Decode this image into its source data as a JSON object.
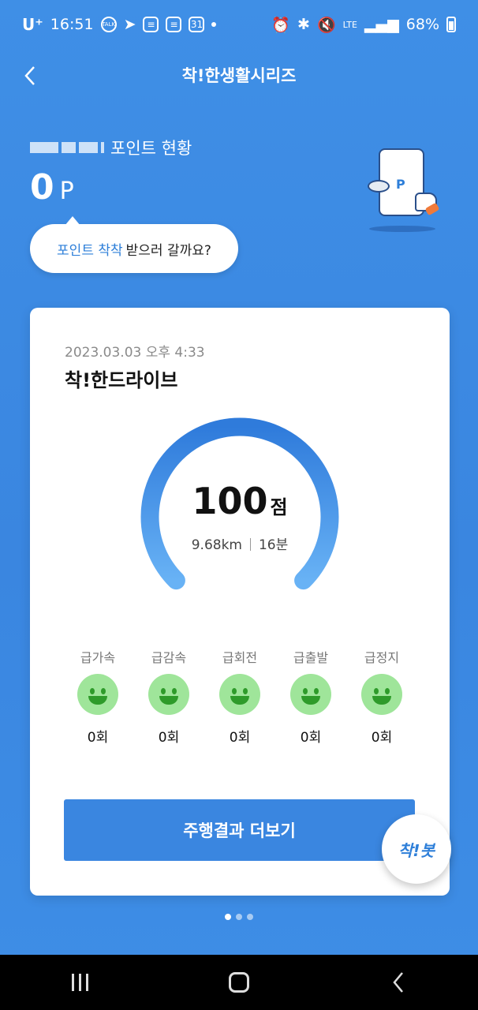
{
  "status_bar": {
    "carrier": "U⁺",
    "time": "16:51",
    "notif_icons": [
      "talk-icon",
      "telegram-icon",
      "note-icon",
      "note-icon",
      "calendar-icon"
    ],
    "calendar_day": "31",
    "talk_label": "TALK",
    "network": "LTE",
    "battery": "68%"
  },
  "header": {
    "title": "착!한생활시리즈"
  },
  "points": {
    "label": "포인트 현황",
    "value": "0",
    "unit": "P"
  },
  "bubble": {
    "highlight": "포인트 착착",
    "text": "받으러 갈까요?"
  },
  "illustration": {
    "phone_letter": "P"
  },
  "card": {
    "date": "2023.03.03 오후 4:33",
    "title": "착!한드라이브",
    "score": "100",
    "score_unit": "점",
    "score_fraction": 1.0,
    "distance": "9.68km",
    "duration": "16분",
    "metrics": [
      {
        "label": "급가속",
        "count": "0회"
      },
      {
        "label": "급감속",
        "count": "0회"
      },
      {
        "label": "급회전",
        "count": "0회"
      },
      {
        "label": "급출발",
        "count": "0회"
      },
      {
        "label": "급정지",
        "count": "0회"
      }
    ],
    "more_button": "주행결과 더보기"
  },
  "bot_button": "착!봇",
  "pager": {
    "count": 3,
    "active": 0
  },
  "colors": {
    "primary": "#3a86e0",
    "face": "#9fe59a",
    "face_feature": "#2e9b2a"
  }
}
